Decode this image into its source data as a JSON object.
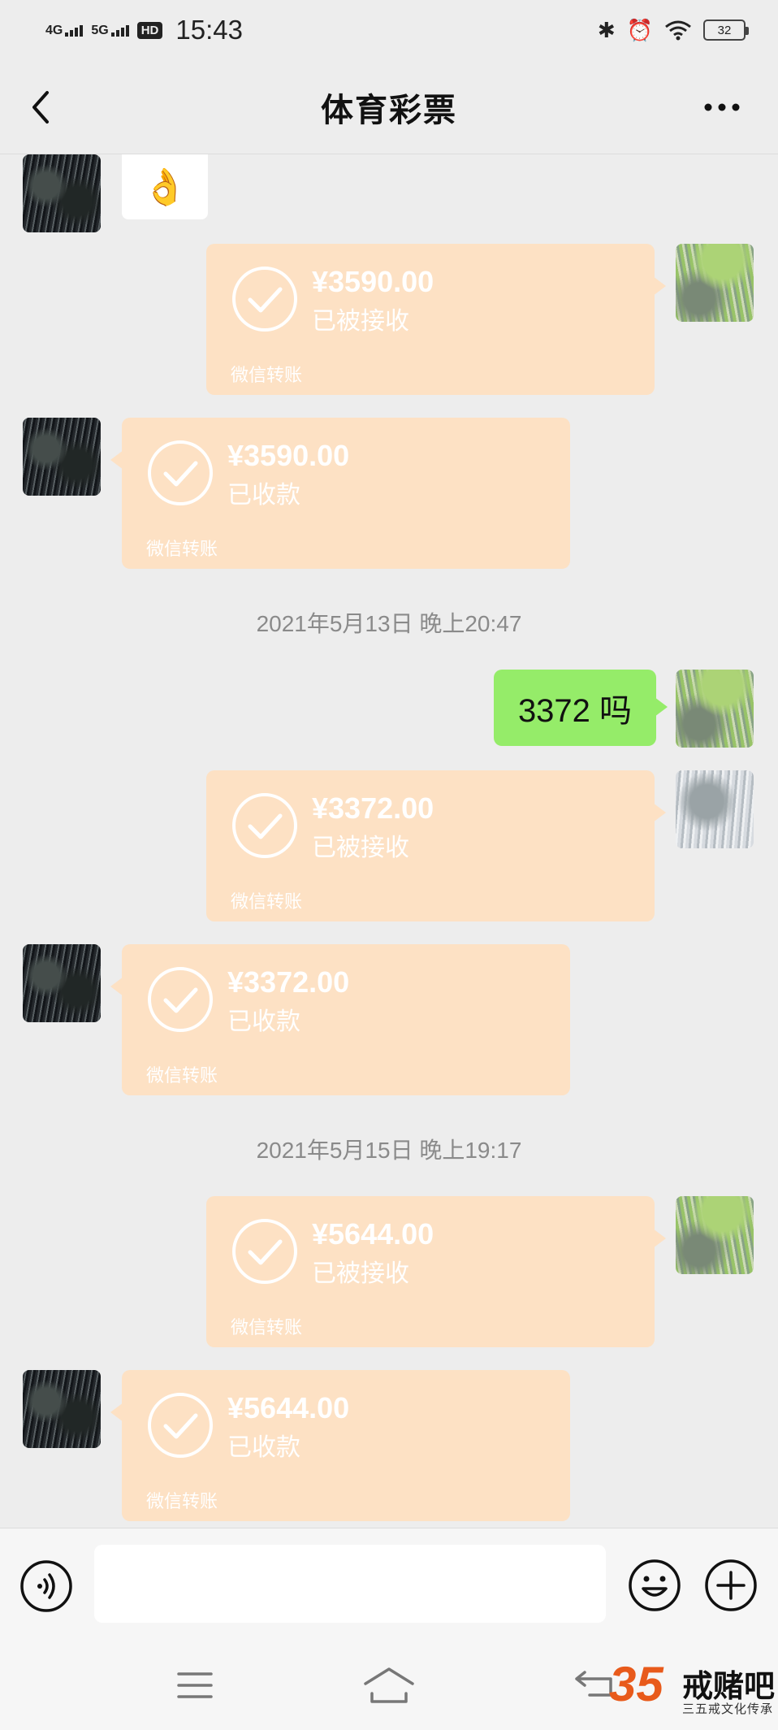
{
  "status_bar": {
    "net1": "4G",
    "net2": "5G",
    "hd": "HD",
    "time": "15:43",
    "battery": "32"
  },
  "header": {
    "title": "体育彩票"
  },
  "messages": [
    {
      "type": "sticker",
      "side": "left",
      "content": "👌"
    },
    {
      "type": "transfer",
      "side": "right",
      "amount": "¥3590.00",
      "status": "已被接收",
      "label": "微信转账"
    },
    {
      "type": "transfer",
      "side": "left",
      "amount": "¥3590.00",
      "status": "已收款",
      "label": "微信转账"
    },
    {
      "type": "timestamp",
      "text": "2021年5月13日 晚上20:47"
    },
    {
      "type": "text",
      "side": "right",
      "text": "3372 吗"
    },
    {
      "type": "transfer",
      "side": "right",
      "amount": "¥3372.00",
      "status": "已被接收",
      "label": "微信转账"
    },
    {
      "type": "transfer",
      "side": "left",
      "amount": "¥3372.00",
      "status": "已收款",
      "label": "微信转账"
    },
    {
      "type": "timestamp",
      "text": "2021年5月15日 晚上19:17"
    },
    {
      "type": "transfer",
      "side": "right",
      "amount": "¥5644.00",
      "status": "已被接收",
      "label": "微信转账"
    },
    {
      "type": "transfer",
      "side": "left",
      "amount": "¥5644.00",
      "status": "已收款",
      "label": "微信转账"
    }
  ],
  "input": {
    "value": "",
    "placeholder": ""
  },
  "watermark": {
    "number": "35",
    "title": "戒赌吧",
    "subtitle": "三五戒文化传承"
  },
  "colors": {
    "background": "#ededed",
    "transfer_bubble": "#fde1c4",
    "text_bubble": "#95ec69",
    "watermark_accent": "#e85a1b"
  }
}
